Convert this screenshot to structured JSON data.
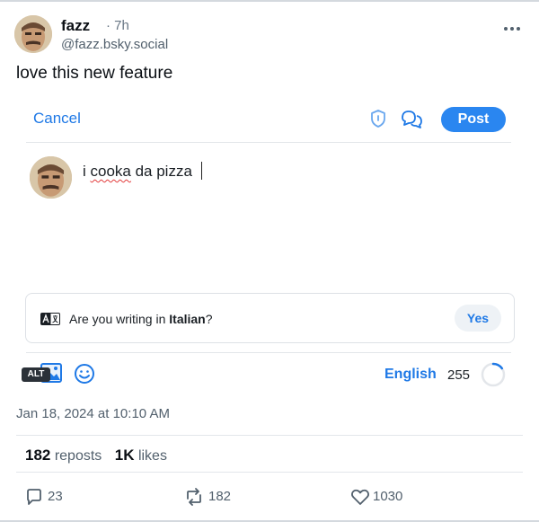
{
  "post": {
    "author_name": "fazz",
    "age": "· 7h",
    "handle": "@fazz.bsky.social",
    "text": "love this new feature",
    "timestamp": "Jan 18, 2024 at 10:10 AM",
    "stats": {
      "reposts_count": "182",
      "reposts_label": "reposts",
      "likes_count": "1K",
      "likes_label": "likes"
    },
    "actions": {
      "replies": "23",
      "reposts": "182",
      "likes": "1030"
    }
  },
  "composer": {
    "cancel_label": "Cancel",
    "post_label": "Post",
    "draft_misspelled_word": "cooka",
    "draft_prefix": "i ",
    "draft_suffix": " da pizza",
    "language_prompt_prefix": "Are you writing in ",
    "language_prompt_language": "Italian",
    "language_prompt_suffix": "?",
    "yes_label": "Yes",
    "alt_badge": "ALT",
    "language": "English",
    "chars_remaining": "255",
    "char_progress": 0.15
  },
  "icons": {
    "more": "more-horizontal-icon",
    "shield": "shield-icon",
    "threadgate": "chat-bubbles-icon",
    "translate": "translate-icon",
    "image": "image-icon",
    "emoji": "emoji-icon",
    "reply": "reply-icon",
    "repost": "repost-icon",
    "like": "heart-icon"
  },
  "colors": {
    "accent": "#1f79e6",
    "post_button": "#2a86f0",
    "muted_text": "#52606d"
  }
}
